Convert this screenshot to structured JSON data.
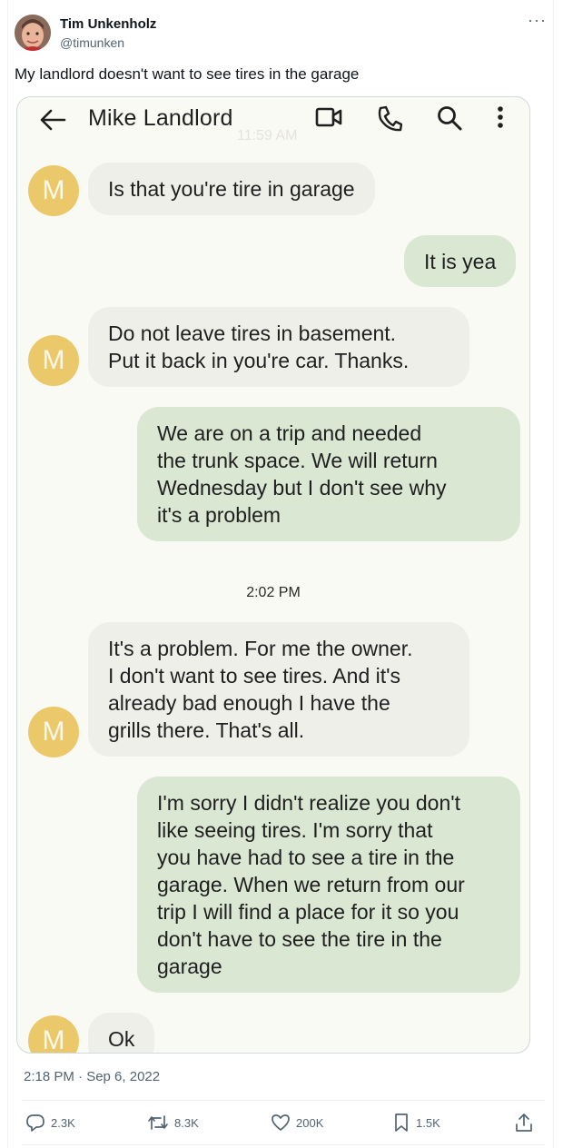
{
  "author": {
    "name": "Tim Unkenholz",
    "handle": "@timunken",
    "more_glyph": "···"
  },
  "tweet": {
    "text": "My landlord doesn't want to see tires in the garage",
    "timestamp": "2:18 PM · Sep 6, 2022"
  },
  "chat": {
    "contact_name": "Mike Landlord",
    "ghost_time": "11:59 AM",
    "avatar_letter": "M",
    "avatar_color": "#ebc96a",
    "incoming_color": "#efefea",
    "outgoing_color": "#d9e7d3",
    "toolbar_icons": [
      "back-arrow-icon",
      "video-call-icon",
      "phone-icon",
      "search-icon",
      "more-vert-icon"
    ],
    "time_divider": "2:02 PM",
    "messages": [
      {
        "from": "them",
        "lines": [
          "Is that you're tire in garage"
        ]
      },
      {
        "from": "me",
        "lines": [
          "It is yea"
        ]
      },
      {
        "from": "them",
        "lines": [
          "Do not leave tires in basement.",
          "Put it back in you're car. Thanks."
        ]
      },
      {
        "from": "me",
        "lines": [
          "We are on a trip and needed",
          "the trunk space. We will return",
          "Wednesday but I don't see why",
          "it's a problem"
        ]
      },
      {
        "from": "them",
        "lines": [
          "It's a problem. For me the owner.",
          "I don't want to see tires. And it's",
          "already bad enough I have the",
          "grills there. That's all."
        ]
      },
      {
        "from": "me",
        "lines": [
          "I'm sorry I didn't realize you don't",
          "like seeing tires. I'm sorry that",
          "you have had to see a tire in the",
          "garage. When we return from our",
          "trip I will find a place for it so you",
          "don't have to see the tire in the",
          "garage"
        ]
      },
      {
        "from": "them",
        "lines": [
          "Ok"
        ]
      }
    ]
  },
  "engagement": {
    "replies": "2.3K",
    "reposts": "8.3K",
    "likes": "200K",
    "bookmarks": "1.5K"
  }
}
